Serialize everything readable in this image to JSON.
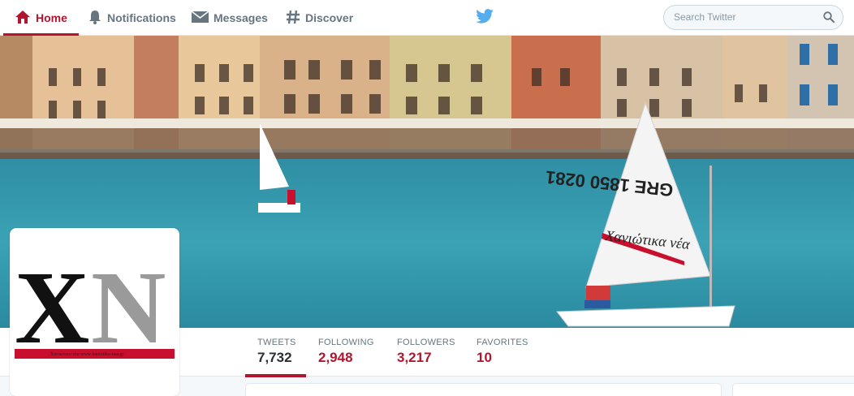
{
  "topbar": {
    "home_label": "Home",
    "notifications_label": "Notifications",
    "messages_label": "Messages",
    "discover_label": "Discover",
    "search_placeholder": "Search Twitter"
  },
  "profile": {
    "avatar_text": "XN",
    "avatar_caption": "Χανιώτικα νέα www.haniotika-nea.gr",
    "sail_text": "Χανιώτικα νέα",
    "sail_number": "GRE 1850 0281"
  },
  "stats": [
    {
      "label": "TWEETS",
      "value": "7,732"
    },
    {
      "label": "FOLLOWING",
      "value": "2,948"
    },
    {
      "label": "FOLLOWERS",
      "value": "3,217"
    },
    {
      "label": "FAVORITES",
      "value": "10"
    }
  ],
  "colors": {
    "accent": "#b0172f",
    "twitter_blue": "#55acee",
    "sea": "#3b9fb2"
  }
}
